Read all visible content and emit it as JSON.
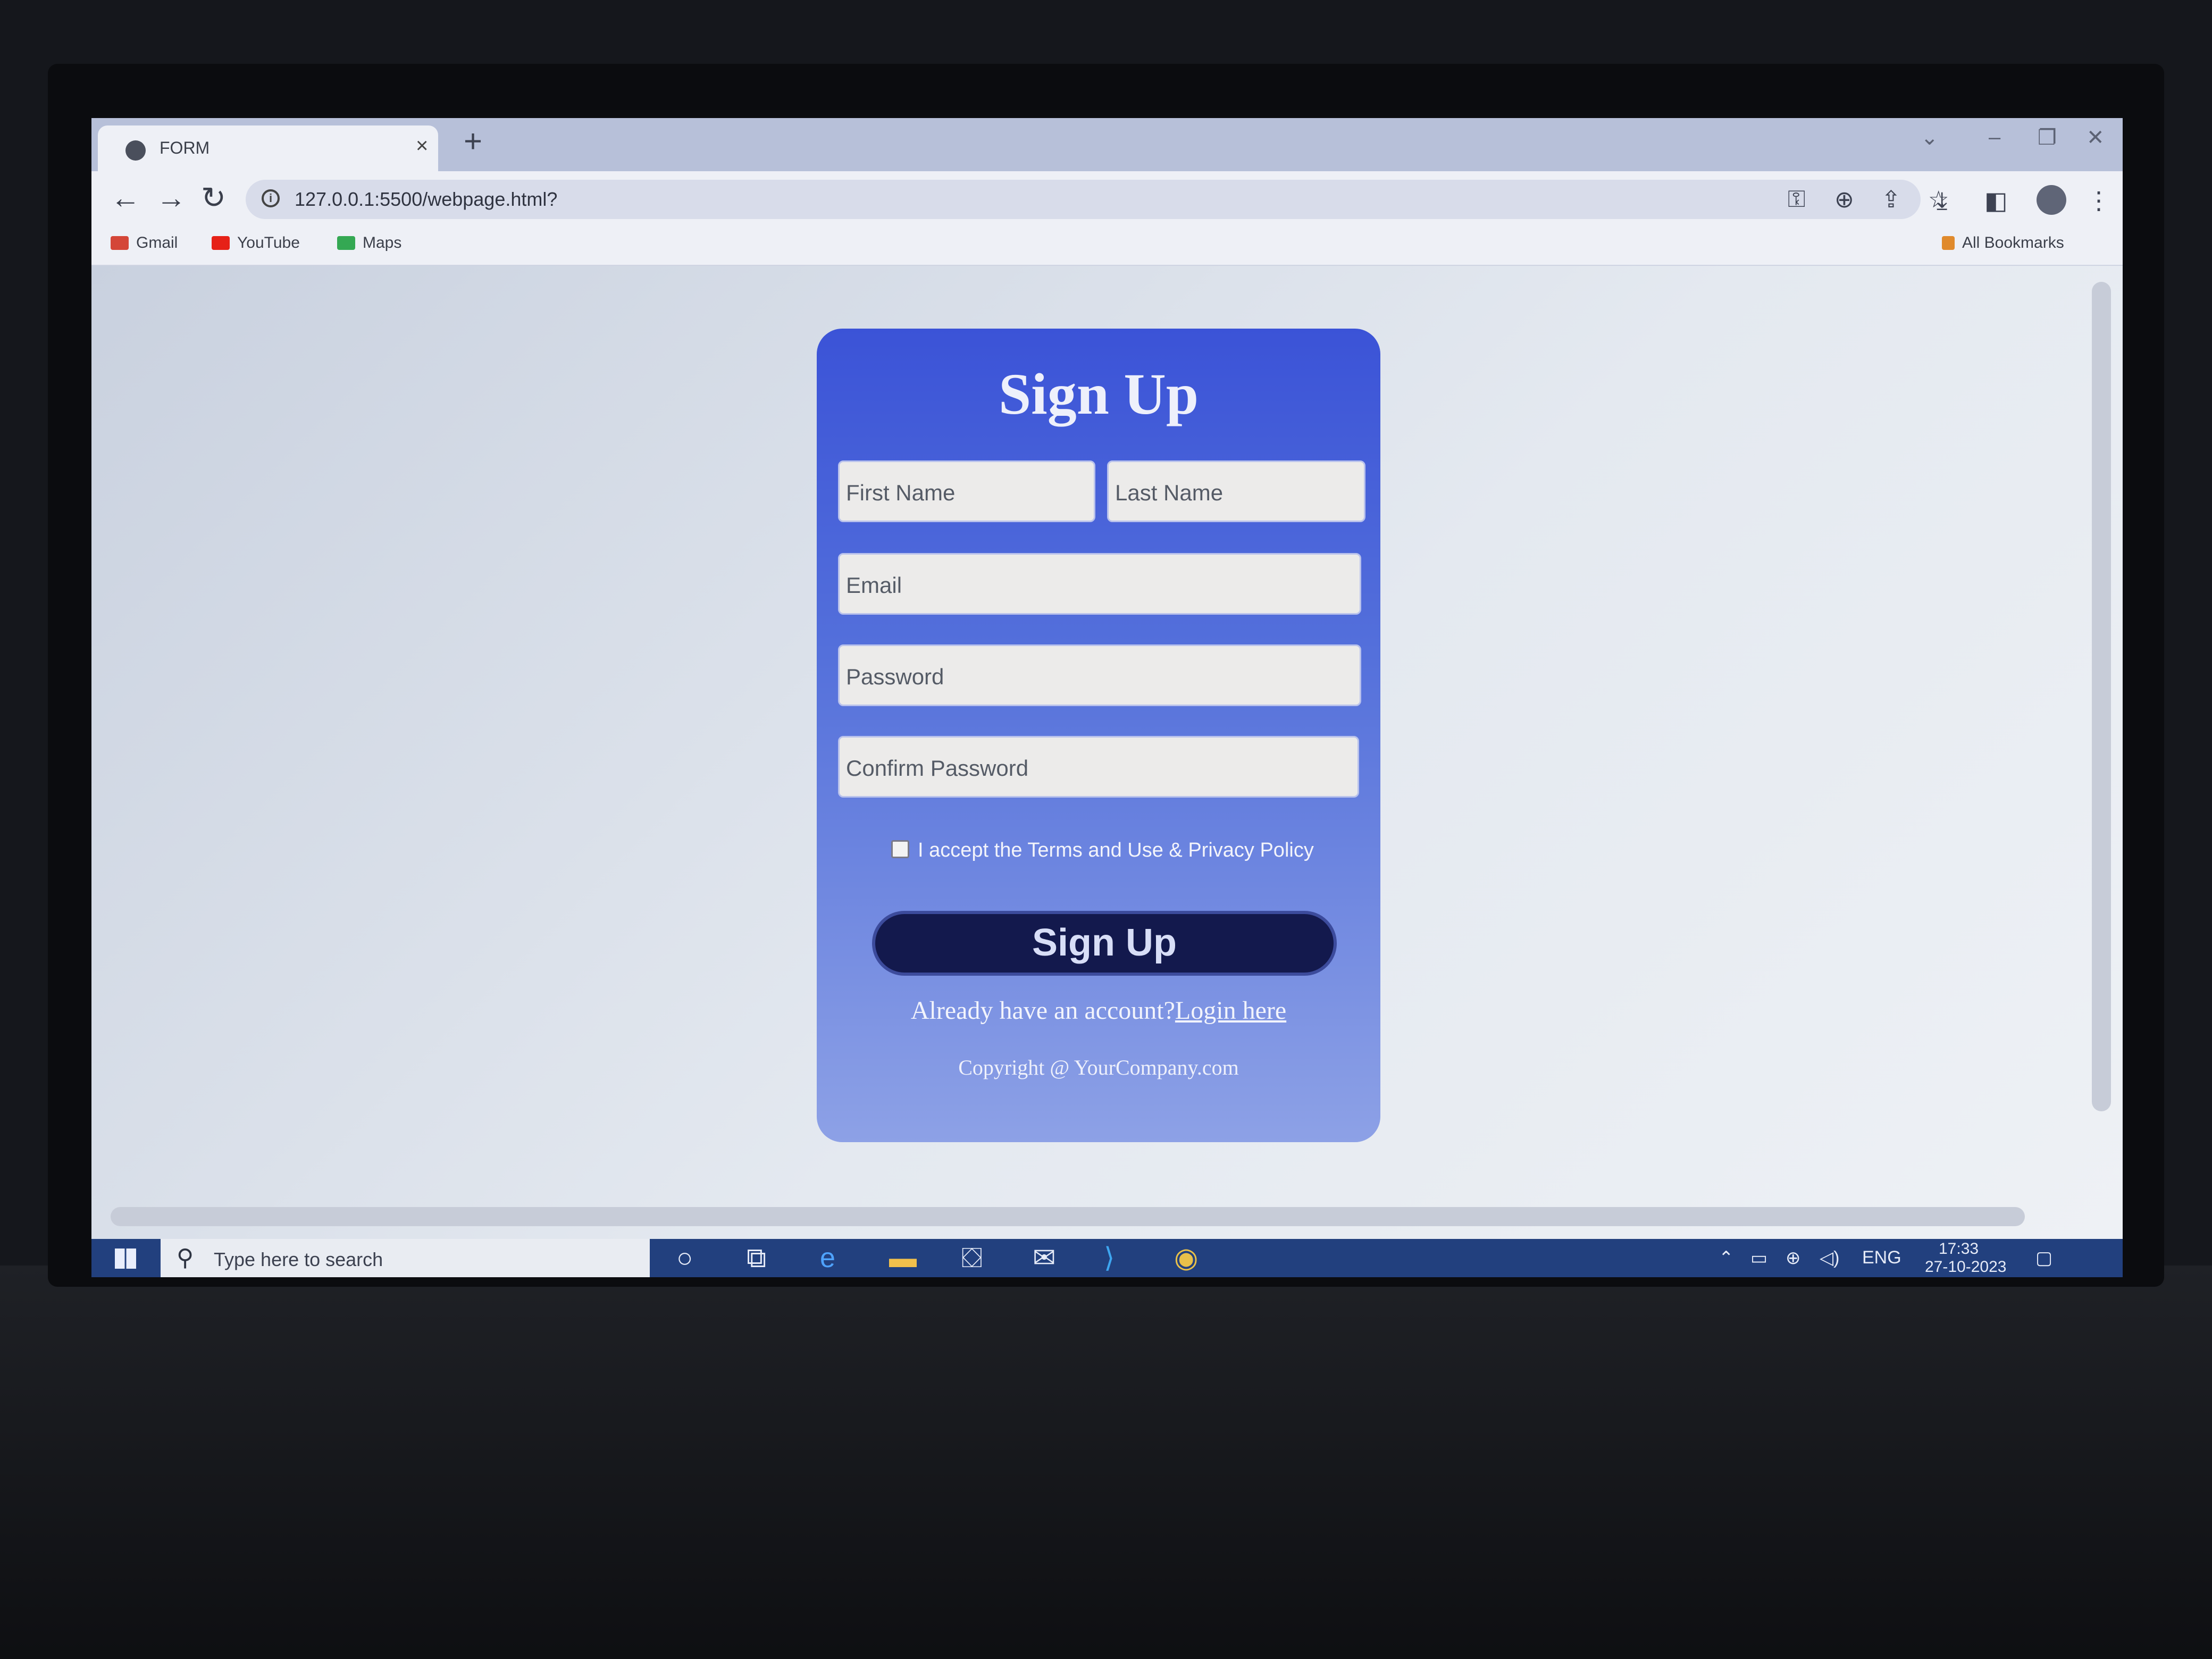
{
  "browser": {
    "tab_title": "FORM",
    "tab_close": "×",
    "new_tab": "+",
    "url": "127.0.0.1:5500/webpage.html?",
    "bookmarks": [
      {
        "label": "Gmail",
        "color": "#d44638"
      },
      {
        "label": "YouTube",
        "color": "#e62117"
      },
      {
        "label": "Maps",
        "color": "#34a853"
      }
    ],
    "all_bookmarks": "All Bookmarks"
  },
  "form": {
    "title": "Sign Up",
    "first_name_placeholder": "First Name",
    "last_name_placeholder": "Last Name",
    "email_placeholder": "Email",
    "password_placeholder": "Password",
    "confirm_password_placeholder": "Confirm Password",
    "terms_label": "I accept the Terms and Use & Privacy Policy",
    "terms_checked": false,
    "submit_label": "Sign Up",
    "login_prompt": "Already have an account?",
    "login_link": "Login here",
    "copyright": "Copyright @ YourCompany.com",
    "card_gradient": [
      "#3b53d7",
      "#8da1e6"
    ],
    "button_color": "#13194d"
  },
  "taskbar": {
    "search_placeholder": "Type here to search",
    "language": "ENG",
    "time": "17:33",
    "date": "27-10-2023"
  }
}
